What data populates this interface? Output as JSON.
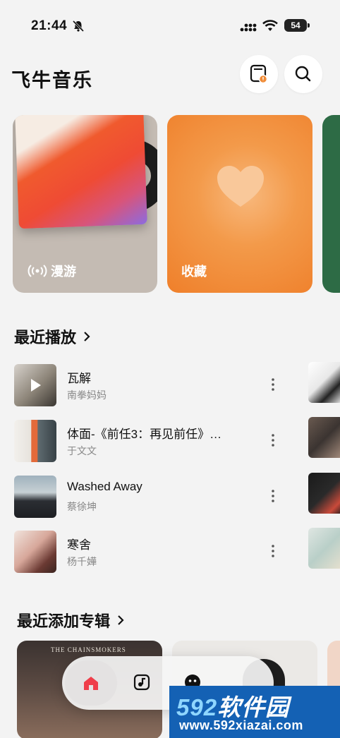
{
  "status_bar": {
    "time": "21:44",
    "battery": "54"
  },
  "header": {
    "title": "飞牛音乐"
  },
  "cards": [
    {
      "label": "漫游"
    },
    {
      "label": "收藏"
    }
  ],
  "recent": {
    "title": "最近播放",
    "songs": [
      {
        "title": "瓦解",
        "artist": "南拳妈妈"
      },
      {
        "title": "体面-《前任3：再见前任》…",
        "artist": "于文文"
      },
      {
        "title": "Washed Away",
        "artist": "蔡徐坤"
      },
      {
        "title": "寒舍",
        "artist": "杨千嬅"
      }
    ]
  },
  "albums": {
    "title": "最近添加专辑",
    "items": [
      {
        "cover_text": "THE CHAINSMOKERS"
      }
    ]
  },
  "nav": {
    "active": "home"
  },
  "watermark": {
    "brand_num": "592",
    "brand_text": "软件园",
    "url": "www.592xiazai.com"
  },
  "colors": {
    "accent": "#ef3e4a",
    "fav_orange": "#f08a34",
    "roam_bg": "#c4bbb3"
  }
}
